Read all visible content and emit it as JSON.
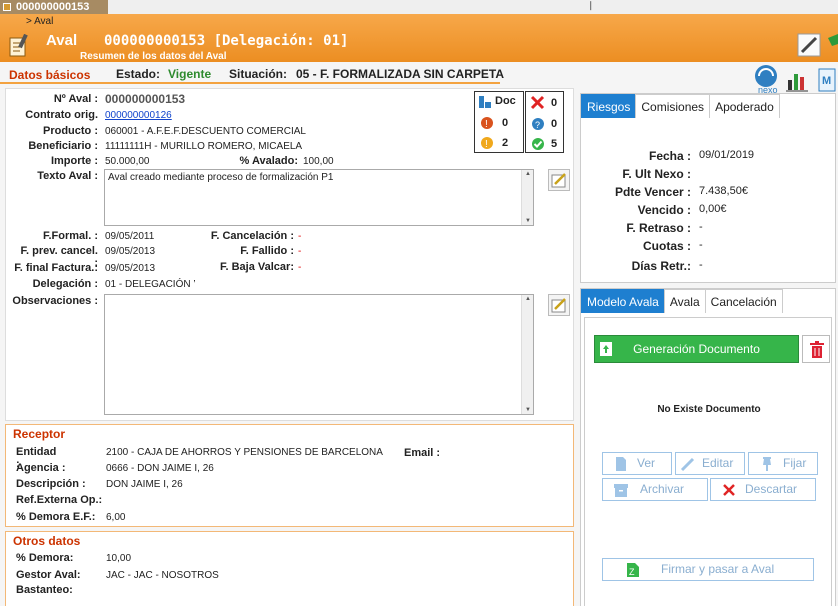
{
  "window": {
    "tab_label": "000000000153",
    "win_controls": "❘"
  },
  "header": {
    "breadcrumb": "> Aval",
    "title": "Aval",
    "code": "000000000153 [Delegación: 01]",
    "subtitle": "Resumen de los datos del Aval"
  },
  "status": {
    "section": "Datos básicos",
    "estado_label": "Estado:",
    "estado_value": "Vigente",
    "situacion_label": "Situación:",
    "situacion_value": "05 - F. FORMALIZADA SIN CARPETA"
  },
  "topicons": {
    "nexo_label": "nexo",
    "m_label": "M"
  },
  "datos": {
    "naval_label": "Nº Aval :",
    "naval_value": "000000000153",
    "contrato_label": "Contrato orig.",
    "contrato_value": "000000000126",
    "producto_label": "Producto :",
    "producto_value": "060001 - A.F.E.F.DESCUENTO COMERCIAL",
    "beneficiario_label": "Beneficiario :",
    "beneficiario_value": "11111111H - MURILLO ROMERO, MICAELA",
    "importe_label": "Importe :",
    "importe_value": "50.000,00",
    "avalado_label": "% Avalado:",
    "avalado_value": "100,00",
    "texto_label": "Texto Aval :",
    "texto_value": "Aval creado mediante proceso de formalización P1",
    "fformal_label": "F.Formal. :",
    "fformal_value": "09/05/2011",
    "fprev_label": "F. prev. cancel. :",
    "fprev_value": "09/05/2013",
    "ffinal_label": "F. final Factura.:",
    "ffinal_value": "09/05/2013",
    "fcancel_label": "F. Cancelación :",
    "fcancel_value": "-",
    "ffallido_label": "F. Fallido :",
    "ffallido_value": "-",
    "fbaja_label": "F. Baja Valcar:",
    "fbaja_value": "-",
    "delegacion_label": "Delegación :",
    "delegacion_value": "01 - DELEGACIÓN ’",
    "obs_label": "Observaciones :",
    "obs_value": ""
  },
  "doc": {
    "doc_label": "Doc",
    "warn_count": "0",
    "warn2_count": "2",
    "err_count": "0",
    "help_count": "0",
    "ok_count": "5"
  },
  "receptor": {
    "title": "Receptor",
    "entidad_label": "Entidad :",
    "entidad_value": "2100 - CAJA DE AHORROS Y PENSIONES DE BARCELONA",
    "email_label": "Email :",
    "email_value": "",
    "agencia_label": "Agencia :",
    "agencia_value": "0666 - DON JAIME I, 26",
    "desc_label": "Descripción :",
    "desc_value": "DON JAIME I, 26",
    "ref_label": "Ref.Externa Op.:",
    "ref_value": "",
    "demora_label": "% Demora E.F.:",
    "demora_value": "6,00"
  },
  "otros": {
    "title": "Otros datos",
    "demora_label": "% Demora:",
    "demora_value": "10,00",
    "gestor_label": "Gestor Aval:",
    "gestor_value": "JAC - JAC - NOSOTROS",
    "bastanteo_label": "Bastanteo:"
  },
  "riesgos": {
    "tabs": [
      "Riesgos",
      "Comisiones",
      "Apoderado"
    ],
    "fecha_label": "Fecha :",
    "fecha_value": "09/01/2019",
    "fult_label": "F. Ult Nexo :",
    "fult_value": "",
    "pdte_label": "Pdte Vencer :",
    "pdte_value": "7.438,50€",
    "vencido_label": "Vencido :",
    "vencido_value": "0,00€",
    "retraso_label": "F. Retraso :",
    "retraso_value": "-",
    "cuotas_label": "Cuotas :",
    "cuotas_value": "-",
    "dias_label": "Días Retr.:",
    "dias_value": "-"
  },
  "modelo": {
    "tabs": [
      "Modelo Avala",
      "Avala",
      "Cancelación"
    ],
    "gen_label": "Generación Documento",
    "no_doc": "No Existe Documento",
    "ver": "Ver",
    "editar": "Editar",
    "fijar": "Fijar",
    "archivar": "Archivar",
    "descartar": "Descartar",
    "firmar": "Firmar y pasar a Aval"
  },
  "colors": {
    "header_orange": "#ec8e22",
    "accent_blue": "#1e7fd0",
    "green": "#36b54a",
    "section_red": "#cc3300"
  }
}
